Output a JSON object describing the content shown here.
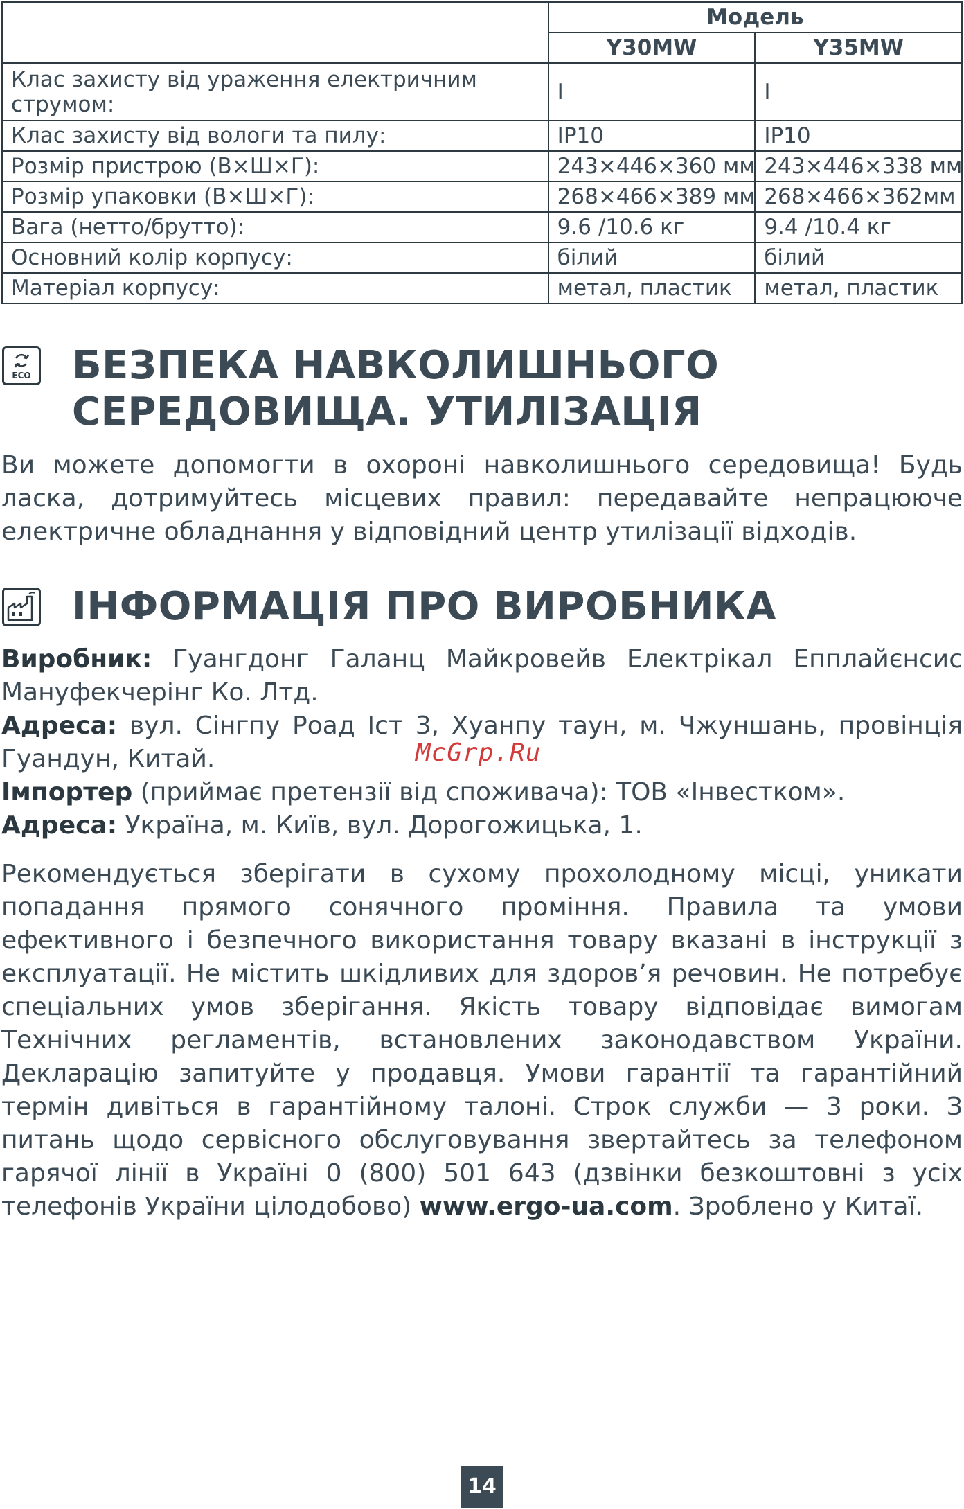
{
  "spec_table": {
    "model_header": "Модель",
    "models": [
      "Y30MW",
      "Y35MW"
    ],
    "rows": [
      {
        "label": "Клас захисту від ураження електричним струмом:",
        "a": "I",
        "b": "I"
      },
      {
        "label": "Клас захисту від вологи та пилу:",
        "a": "IP10",
        "b": "IP10"
      },
      {
        "label": "Розмір пристрою (В×Ш×Г):",
        "a": "243×446×360 мм",
        "b": "243×446×338 мм"
      },
      {
        "label": "Розмір упаковки (В×Ш×Г):",
        "a": "268×466×389 мм",
        "b": "268×466×362мм"
      },
      {
        "label": "Вага (нетто/брутто):",
        "a": "9.6 /10.6 кг",
        "b": "9.4 /10.4 кг"
      },
      {
        "label": "Основний колір корпусу:",
        "a": "білий",
        "b": "білий"
      },
      {
        "label": "Матеріал корпусу:",
        "a": "метал, пластик",
        "b": "метал, пластик"
      }
    ]
  },
  "eco_section": {
    "icon": "eco-recycle-icon",
    "icon_text": "ECO",
    "title_line1": "БЕЗПЕКА НАВКОЛИШНЬОГО",
    "title_line2": "СЕРЕДОВИЩА. УТИЛІЗАЦІЯ",
    "body": "Ви можете допомогти в охороні навколишнього середовища! Будь ласка, дотримуйтесь місцевих правил: передавайте непрацююче електричне обладнання у відповідний центр утилізації відходів."
  },
  "manufacturer_section": {
    "icon": "factory-icon",
    "title": "ІНФОРМАЦІЯ ПРО ВИРОБНИКА",
    "manufacturer_label": "Виробник:",
    "manufacturer_value": " Гуангдонг Галанц Майкровейв Електрікал Епплайєнсис Мануфекчерінг Ко. Лтд.",
    "address_label": "Адреса:",
    "address_value": " вул. Сінгпу Роад Іст 3, Хуанпу таун, м. Чжуншань, провінція Гуандун, Китай.",
    "importer_label": "Імпортер",
    "importer_value": " (приймає претензії від споживача): ТОВ «Інвестком».",
    "importer_address_label": "Адреса:",
    "importer_address_value": " Україна, м. Київ, вул. Дорогожицька, 1.",
    "notes_text": "Рекомендується зберігати в сухому прохолодному місці, уникати попадання прямого сонячного проміння. Правила та умови ефективного і безпечного використання товару вказані в інструкції з експлуатації. Не містить шкідливих для здоров’я речовин. Не потребує спеціальних умов зберігання. Якість товару відповідає вимогам Технічних регламентів, встановлених законодавством України. Декларацію запитуйте у продавця. Умови гарантії та гарантійний термін дивіться в гарантійному талоні. Строк служби — 3 роки. З питань щодо сервісного обслуговування звертайтесь за телефоном гарячої лінії в Україні 0 (800) 501 643 (дзвінки безкоштовні з усіх телефонів України цілодобово) ",
    "website": "www.ergo-ua.com",
    "notes_tail": ". Зроблено у Китаї."
  },
  "watermark": "McGrp.Ru",
  "page_number": "14",
  "colors": {
    "text": "#3b4a54",
    "watermark": "#d33a3a",
    "page_badge": "#3b4a54"
  }
}
